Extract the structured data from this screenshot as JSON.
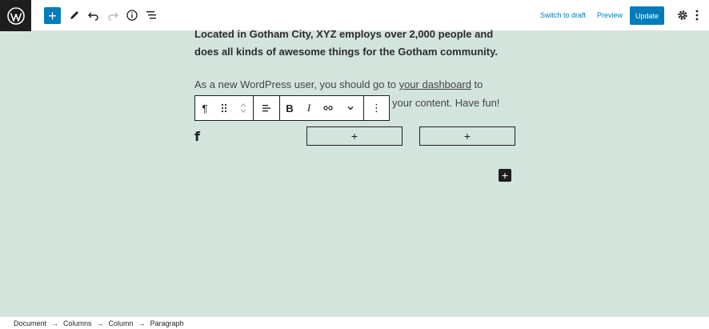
{
  "toolbar": {
    "switch_to_draft": "Switch to draft",
    "preview": "Preview",
    "update": "Update",
    "inserter_icon": "plus-icon"
  },
  "content": {
    "bold_paragraph": "Located in Gotham City, XYZ employs over 2,000 people and does all kinds of awesome things for the Gotham community.",
    "paragraph_start": "As a new WordPress user, you should go to ",
    "paragraph_link": "your dashboard",
    "paragraph_after_link": " to",
    "paragraph_line2": "your content. Have fun!",
    "facebook_glyph": "f"
  },
  "block_toolbar": {
    "paragraph_glyph": "¶",
    "bold": "B",
    "italic": "I",
    "more": "⋮"
  },
  "appenders": {
    "plus": "+"
  },
  "breadcrumb": [
    "Document",
    "Columns",
    "Column",
    "Paragraph"
  ],
  "breadcrumb_sep": "→",
  "colors": {
    "accent": "#007cba",
    "canvas": "#d3e4dd",
    "dark": "#1e1e1e"
  }
}
